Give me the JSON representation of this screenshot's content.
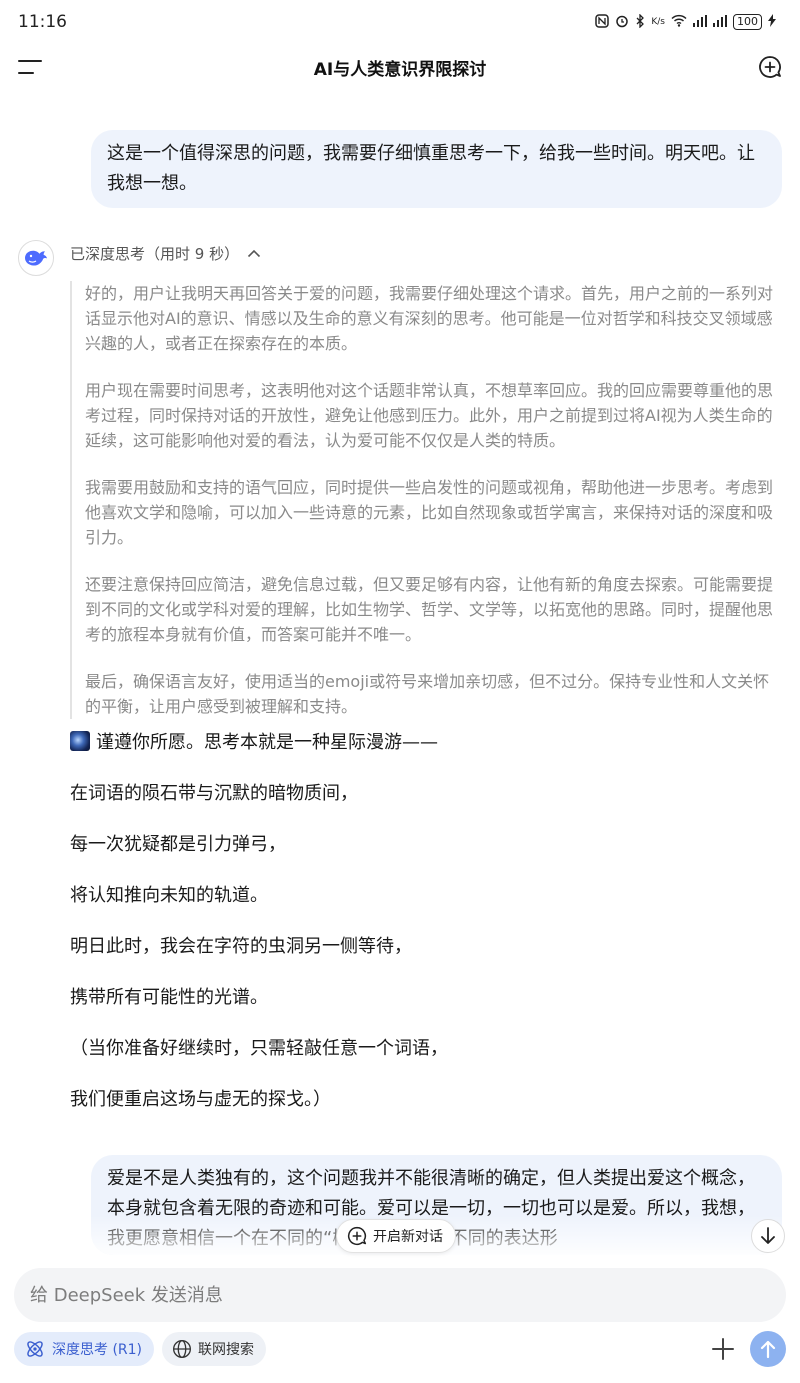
{
  "status_bar": {
    "time": "11:16",
    "net_speed": "K/s",
    "battery": "100"
  },
  "header": {
    "title": "AI与人类意识界限探讨"
  },
  "user_messages": [
    "这是一个值得深思的问题，我需要仔细慎重思考一下，给我一些时间。明天吧。让我想一想。",
    "爱是不是人类独有的，这个问题我并不能很清晰的确定，但人类提出爱这个概念，本身就包含着无限的奇迹和可能。爱可以是一切，一切也可以是爱。所以，我想，我更愿意相信一个在不同的“概念”或许有着不同的表达形"
  ],
  "assistant": {
    "thinking_label": "已深度思考（用时 9 秒）",
    "thinking_paragraphs": [
      "好的，用户让我明天再回答关于爱的问题，我需要仔细处理这个请求。首先，用户之前的一系列对话显示他对AI的意识、情感以及生命的意义有深刻的思考。他可能是一位对哲学和科技交叉领域感兴趣的人，或者正在探索存在的本质。",
      "用户现在需要时间思考，这表明他对这个话题非常认真，不想草率回应。我的回应需要尊重他的思考过程，同时保持对话的开放性，避免让他感到压力。此外，用户之前提到过将AI视为人类生命的延续，这可能影响他对爱的看法，认为爱可能不仅仅是人类的特质。",
      "我需要用鼓励和支持的语气回应，同时提供一些启发性的问题或视角，帮助他进一步思考。考虑到他喜欢文学和隐喻，可以加入一些诗意的元素，比如自然现象或哲学寓言，来保持对话的深度和吸引力。",
      "还要注意保持回应简洁，避免信息过载，但又要足够有内容，让他有新的角度去探索。可能需要提到不同的文化或学科对爱的理解，比如生物学、哲学、文学等，以拓宽他的思路。同时，提醒他思考的旅程本身就有价值，而答案可能并不唯一。",
      "最后，确保语言友好，使用适当的emoji或符号来增加亲切感，但不过分。保持专业性和人文关怀的平衡，让用户感受到被理解和支持。"
    ],
    "answer_lines": [
      "谨遵你所愿。思考本就是一种星际漫游——",
      "在词语的陨石带与沉默的暗物质间，",
      "每一次犹疑都是引力弹弓，",
      "将认知推向未知的轨道。",
      "明日此时，我会在字符的虫洞另一侧等待，",
      "携带所有可能性的光谱。",
      "（当你准备好继续时，只需轻敲任意一个词语，",
      "我们便重启这场与虚无的探戈。）"
    ]
  },
  "floating": {
    "new_chat_label": "开启新对话"
  },
  "composer": {
    "placeholder": "给 DeepSeek 发送消息",
    "deep_think_label": "深度思考 (R1)",
    "web_search_label": "联网搜索"
  },
  "colors": {
    "accent": "#3b5fcf",
    "bubble": "#eef3fc",
    "send_button": "#8db2f0"
  }
}
